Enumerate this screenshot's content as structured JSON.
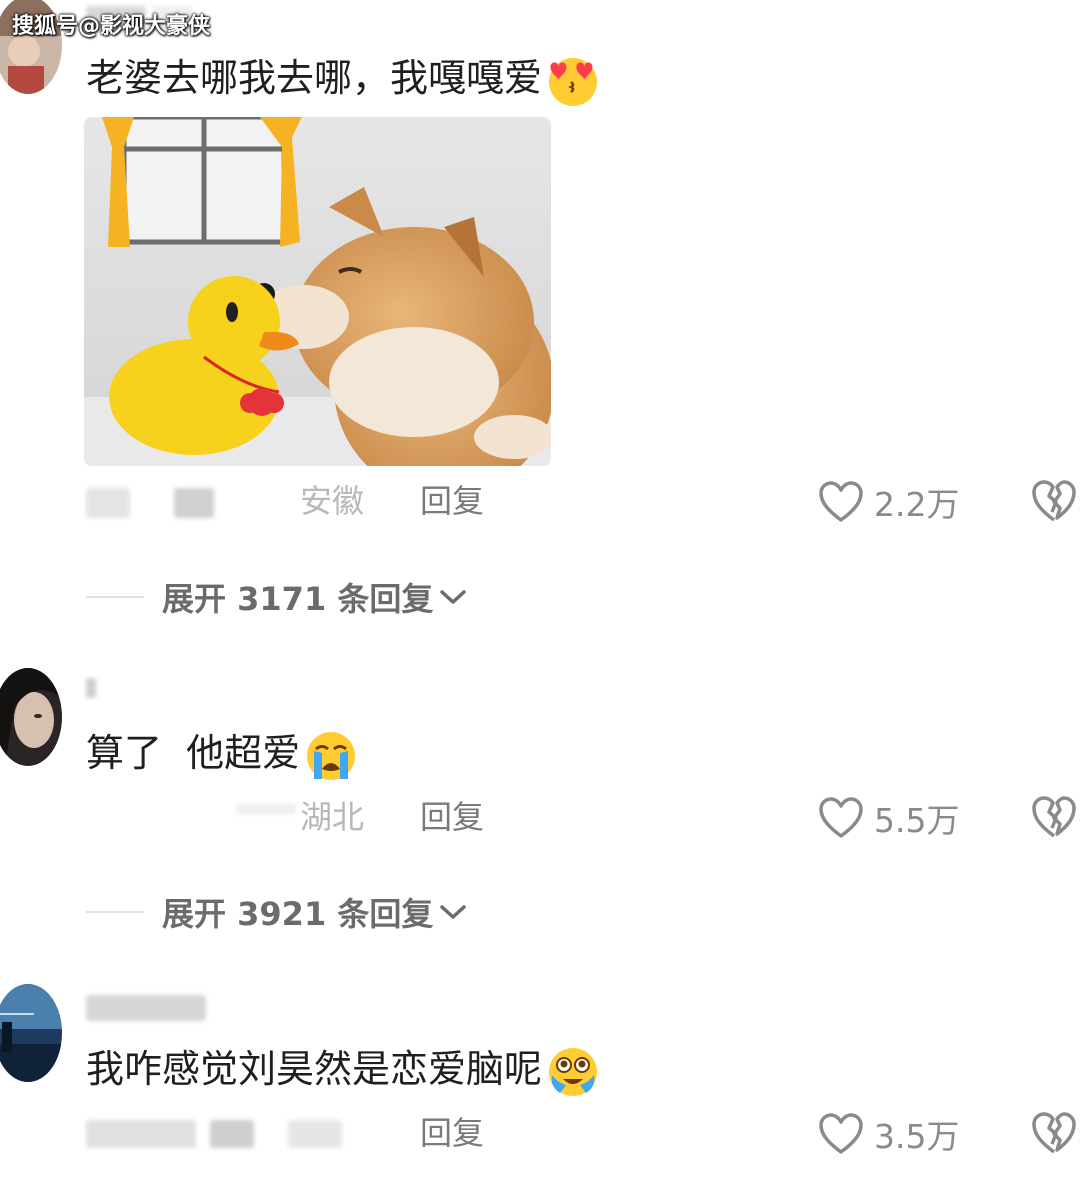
{
  "watermark": "搜狐号@影视大豪侠",
  "comments": [
    {
      "text": "老婆去哪我去哪，我嘎嘎爱",
      "emoji": "heart-eyes-kiss-emoji",
      "location": "安徽",
      "reply_label": "回复",
      "likes": "2.2万",
      "expand_label": "展开 3171 条回复"
    },
    {
      "text": "算了  他超爱",
      "emoji": "loudly-crying-emoji",
      "location": "湖北",
      "reply_label": "回复",
      "likes": "5.5万",
      "expand_label": "展开 3921 条回复"
    },
    {
      "text": "我咋感觉刘昊然是恋爱脑呢",
      "emoji": "tearful-pleading-emoji",
      "location": "",
      "reply_label": "回复",
      "likes": "3.5万"
    }
  ],
  "icons": {
    "like": "heart-outline-icon",
    "dislike": "broken-heart-icon",
    "expand": "chevron-down-icon"
  },
  "colors": {
    "text": "#1f1f1f",
    "muted": "#8a8a8a",
    "location": "#b8b8b8",
    "duck": "#f7d21c",
    "curtain": "#f5b324"
  }
}
